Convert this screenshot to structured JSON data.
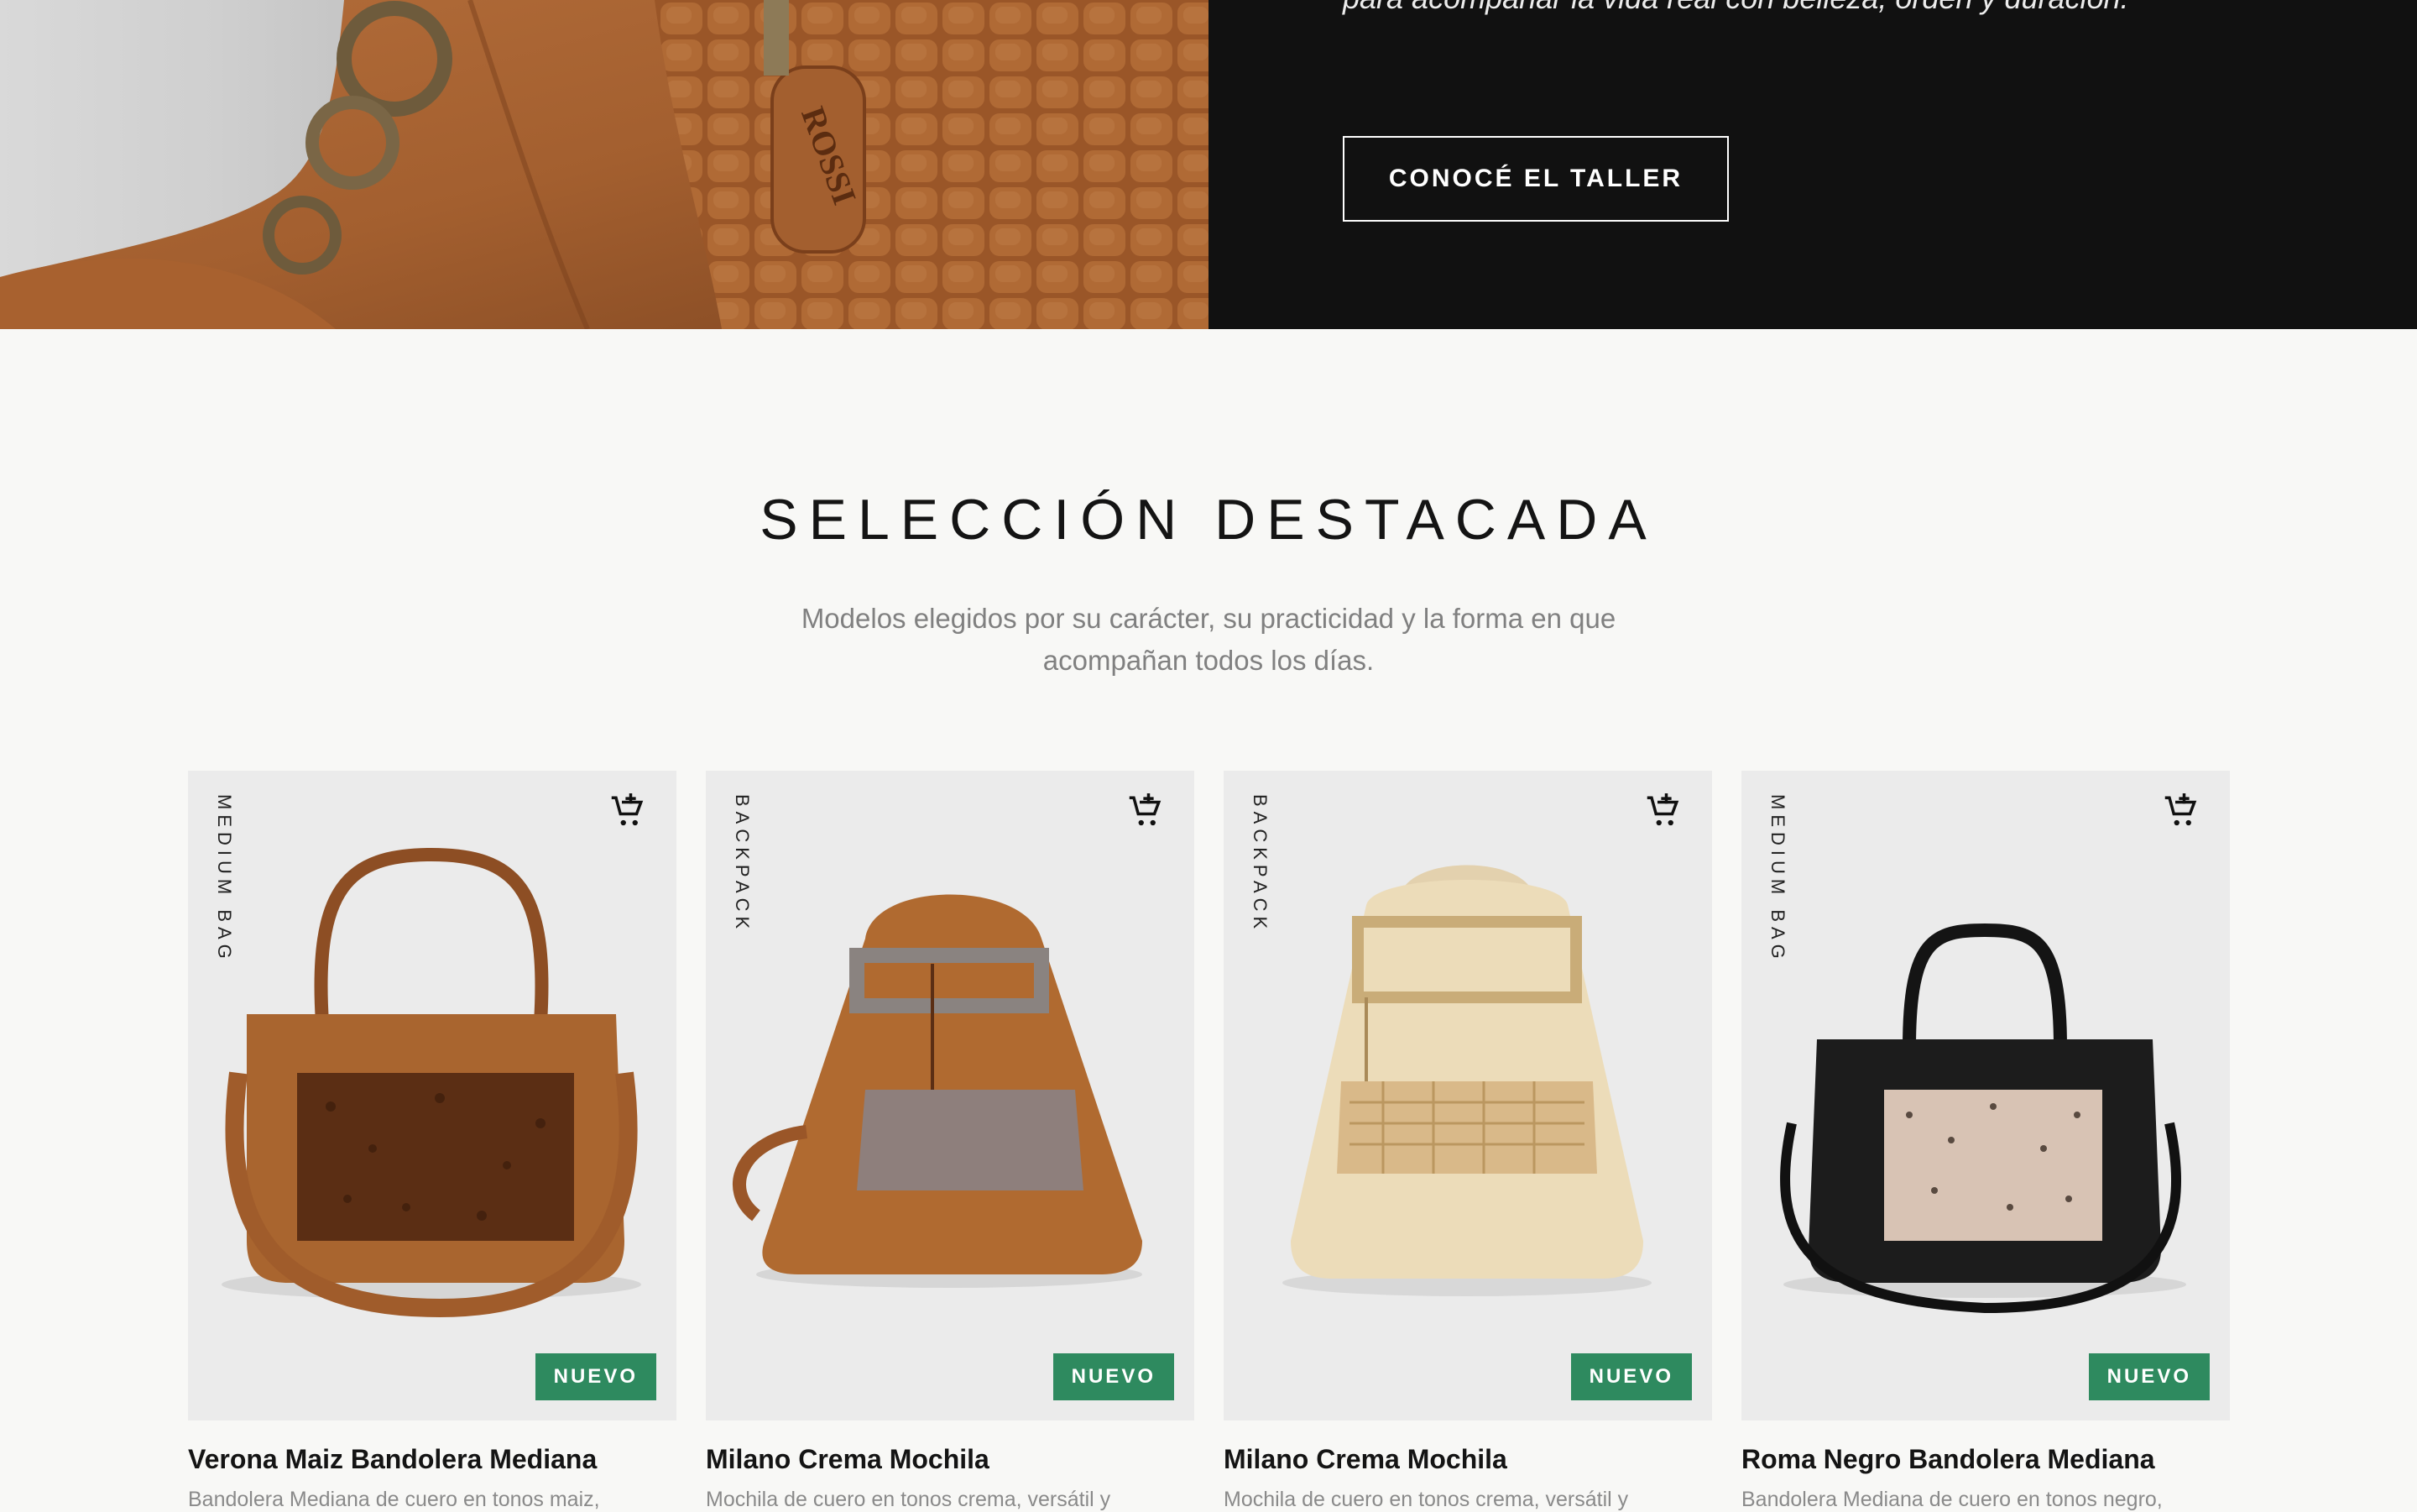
{
  "hero_band": {
    "quote": "para acompañar la vida real con belleza, orden y duración.”",
    "cta_label": "CONOCÉ EL TALLER",
    "brand_tag": "ROSSI"
  },
  "featured": {
    "title": "SELECCIÓN DESTACADA",
    "subtitle": "Modelos elegidos por su carácter, su practicidad y la forma en que acompañan todos los días."
  },
  "products": [
    {
      "category": "MEDIUM BAG",
      "badge": "NUEVO",
      "name": "Verona Maiz Bandolera Mediana",
      "description": "Bandolera Mediana de cuero en tonos maiz,"
    },
    {
      "category": "BACKPACK",
      "badge": "NUEVO",
      "name": "Milano Crema Mochila",
      "description": "Mochila de cuero en tonos crema, versátil y"
    },
    {
      "category": "BACKPACK",
      "badge": "NUEVO",
      "name": "Milano Crema Mochila",
      "description": "Mochila de cuero en tonos crema, versátil y"
    },
    {
      "category": "MEDIUM BAG",
      "badge": "NUEVO",
      "name": "Roma Negro Bandolera Mediana",
      "description": "Bandolera Mediana de cuero en tonos negro,"
    }
  ],
  "icons": {
    "cart": "add-to-cart-icon"
  },
  "colors": {
    "badge": "#2e8a5f",
    "dark_band": "#111111",
    "page_bg": "#f8f8f6"
  }
}
